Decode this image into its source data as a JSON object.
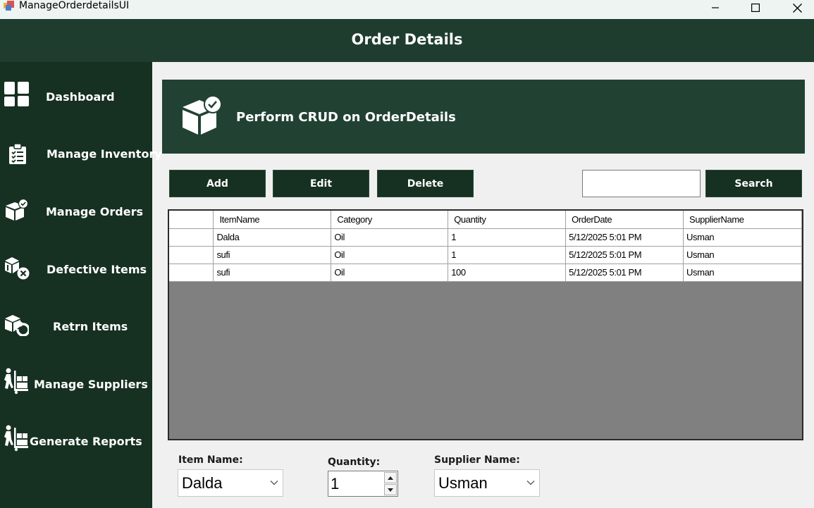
{
  "window": {
    "title": "ManageOrderdetailsUI"
  },
  "header": {
    "title": "Order Details"
  },
  "sidebar": {
    "items": [
      {
        "label": "Dashboard",
        "icon": "dashboard-icon"
      },
      {
        "label": "Manage Inventory",
        "icon": "clipboard-checklist-icon"
      },
      {
        "label": "Manage Orders",
        "icon": "box-check-icon"
      },
      {
        "label": "Defective Items",
        "icon": "defective-boxes-icon"
      },
      {
        "label": "Retrn Items",
        "icon": "return-box-icon"
      },
      {
        "label": "Manage Suppliers",
        "icon": "supplier-dolly-icon"
      },
      {
        "label": "Generate Reports",
        "icon": "supplier-dolly-icon"
      }
    ]
  },
  "banner": {
    "text": "Perform CRUD on OrderDetails",
    "icon": "box-check-icon"
  },
  "toolbar": {
    "add_label": "Add",
    "edit_label": "Edit",
    "delete_label": "Delete",
    "search_value": "",
    "search_label": "Search"
  },
  "grid": {
    "columns": [
      "ItemName",
      "Category",
      "Quantity",
      "OrderDate",
      "SupplierName"
    ],
    "rows": [
      [
        "Dalda",
        "Oil",
        "1",
        "5/12/2025 5:01 PM",
        "Usman"
      ],
      [
        "sufi",
        "Oil",
        "1",
        "5/12/2025 5:01 PM",
        "Usman"
      ],
      [
        "sufi",
        "Oil",
        "100",
        "5/12/2025 5:01 PM",
        "Usman"
      ]
    ]
  },
  "form": {
    "item_name_label": "Item Name:",
    "item_name_value": "Dalda",
    "quantity_label": "Quantity:",
    "quantity_value": "1",
    "supplier_name_label": "Supplier Name:",
    "supplier_name_value": "Usman"
  },
  "colors": {
    "header_bg": "#1f3d2f",
    "sidebar_bg": "#163021",
    "banner_bg": "#214233",
    "button_bg": "#163021",
    "grid_empty_bg": "#808080"
  }
}
